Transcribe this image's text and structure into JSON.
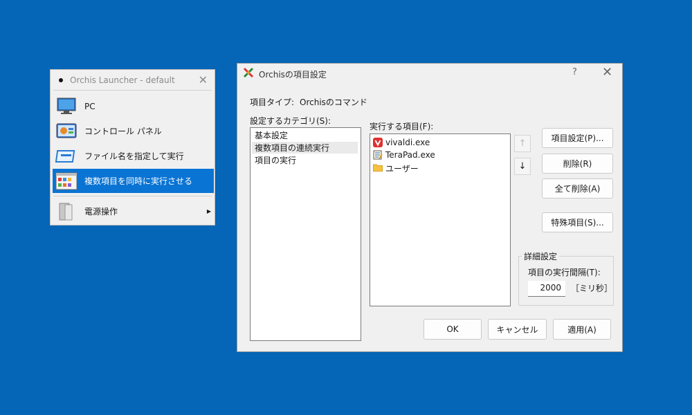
{
  "launcher": {
    "title": "Orchis Launcher - default",
    "items": [
      {
        "label": "PC",
        "icon": "monitor-icon"
      },
      {
        "label": "コントロール パネル",
        "icon": "control-panel-icon"
      },
      {
        "label": "ファイル名を指定して実行",
        "icon": "run-icon"
      },
      {
        "label": "複数項目を同時に実行させる",
        "icon": "multi-run-icon",
        "selected": true
      },
      {
        "label": "電源操作",
        "icon": "power-icon",
        "submenu": true
      }
    ]
  },
  "dialog": {
    "title": "Orchisの項目設定",
    "help": "?",
    "item_type_label": "項目タイプ:",
    "item_type_value": "Orchisのコマンド",
    "category_label": "設定するカテゴリ(S):",
    "categories": [
      "基本設定",
      "複数項目の連続実行",
      "項目の実行"
    ],
    "execute_label": "実行する項目(F):",
    "execute_items": [
      {
        "label": "vivaldi.exe",
        "icon": "vivaldi-icon"
      },
      {
        "label": "TeraPad.exe",
        "icon": "terapad-icon"
      },
      {
        "label": "ユーザー",
        "icon": "folder-icon"
      }
    ],
    "up_arrow": "↑",
    "down_arrow": "↓",
    "buttons": {
      "item_settings": "項目設定(P)...",
      "delete": "削除(R)",
      "delete_all": "全て削除(A)",
      "special_item": "特殊項目(S)...",
      "ok": "OK",
      "cancel": "キャンセル",
      "apply": "適用(A)"
    },
    "detail": {
      "group_label": "詳細設定",
      "interval_label": "項目の実行間隔(T):",
      "interval_value": "2000",
      "unit": "［ミリ秒］"
    }
  },
  "colors": {
    "desktop": "#0565b6",
    "selection": "#0a74d4",
    "vivaldi": "#e0312f",
    "folder": "#f5c242"
  }
}
